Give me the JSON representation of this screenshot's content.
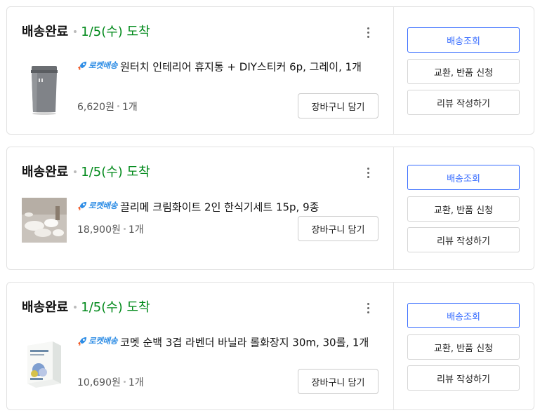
{
  "badge_text": "로켓배송",
  "colors": {
    "accent_blue": "#346aff",
    "arrival_green": "#00891a",
    "rocket_blue": "#2e8de5"
  },
  "orders": [
    {
      "status": "배송완료",
      "arrival": "1/5(수) 도착",
      "title": "원터치 인테리어 휴지통 + DIY스티커 6p, 그레이, 1개",
      "price": "6,620원",
      "qty": "1개",
      "cart_label": "장바구니 담기",
      "actions": [
        "배송조회",
        "교환, 반품 신청",
        "리뷰 작성하기"
      ],
      "thumb_icon": "trash-bin-product-image"
    },
    {
      "status": "배송완료",
      "arrival": "1/5(수) 도착",
      "title": "끌리메 크림화이트 2인 한식기세트 15p, 9종",
      "price": "18,900원",
      "qty": "1개",
      "cart_label": "장바구니 담기",
      "actions": [
        "배송조회",
        "교환, 반품 신청",
        "리뷰 작성하기"
      ],
      "thumb_icon": "dish-set-product-image"
    },
    {
      "status": "배송완료",
      "arrival": "1/5(수) 도착",
      "title": "코멧 순백 3겹 라벤더 바닐라 롤화장지 30m, 30롤, 1개",
      "price": "10,690원",
      "qty": "1개",
      "cart_label": "장바구니 담기",
      "actions": [
        "배송조회",
        "교환, 반품 신청",
        "리뷰 작성하기"
      ],
      "thumb_icon": "toilet-paper-product-image"
    }
  ]
}
